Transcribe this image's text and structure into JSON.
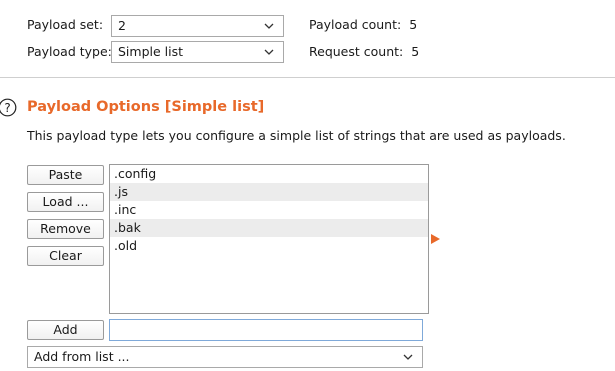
{
  "payload_set": {
    "label": "Payload set:",
    "value": "2"
  },
  "payload_type": {
    "label": "Payload type:",
    "value": "Simple list"
  },
  "payload_count": {
    "label": "Payload count:",
    "value": "5"
  },
  "request_count": {
    "label": "Request count:",
    "value": "5"
  },
  "options": {
    "title": "Payload Options [Simple list]",
    "description": "This payload type lets you configure a simple list of strings that are used as payloads."
  },
  "buttons": {
    "paste": "Paste",
    "load": "Load ...",
    "remove": "Remove",
    "clear": "Clear",
    "add": "Add"
  },
  "list": [
    ".config",
    ".js",
    ".inc",
    ".bak",
    ".old"
  ],
  "add_input": {
    "value": "",
    "placeholder": ""
  },
  "add_from_list": {
    "value": "Add from list ..."
  },
  "colors": {
    "accent": "#e8692a",
    "list_alt_row": "#ececec",
    "input_focus_border": "#7fa9d9"
  },
  "icons": {
    "help": "question-circle-icon",
    "dropdown": "chevron-down-icon",
    "arrow": "red-triangle-right-icon"
  }
}
